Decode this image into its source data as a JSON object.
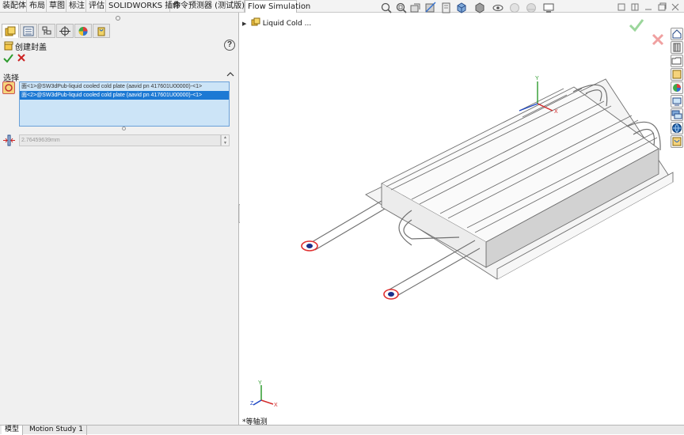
{
  "command_tabs": [
    {
      "label": "装配体",
      "active": false
    },
    {
      "label": "布局",
      "active": false
    },
    {
      "label": "草图",
      "active": false
    },
    {
      "label": "标注",
      "active": false
    },
    {
      "label": "评估",
      "active": false
    },
    {
      "label": "SOLIDWORKS 插件",
      "active": false
    },
    {
      "label": "命令预测器 (测试版)",
      "active": false
    },
    {
      "label": "Flow Simulation",
      "active": true
    }
  ],
  "manager_tabs": [
    {
      "icon": "featuremanager-icon",
      "selected": true
    },
    {
      "icon": "propertymanager-icon",
      "selected": false
    },
    {
      "icon": "configurationmanager-icon",
      "selected": false
    },
    {
      "icon": "dimxpert-icon",
      "selected": false
    },
    {
      "icon": "appearance-icon",
      "selected": false
    },
    {
      "icon": "flow-analysis-tree-icon",
      "selected": false
    }
  ],
  "property_manager": {
    "title": "创建封盖",
    "help": "?",
    "ok_icon": "checkmark-icon",
    "cancel_icon": "cross-icon",
    "selection_group": {
      "header": "选择",
      "faces": [
        "面<1>@SW3dPub-liquid cooled cold plate (aavid pn 417601U00000)-<1>",
        "面<2>@SW3dPub-liquid cooled cold plate (aavid pn 417601U00000)-<1>"
      ],
      "selected_index": 1
    },
    "thickness": {
      "value": "2.76459639mm",
      "up": "▲",
      "down": "▼"
    }
  },
  "viewport": {
    "tree_root_label": "Liquid Cold ...",
    "tree_arrow": "▶",
    "view_orientation": "*等轴测",
    "triad_labels": {
      "x": "X",
      "y": "Y",
      "z": "Z"
    }
  },
  "bottom_tabs": [
    {
      "label": "模型",
      "active": true
    },
    {
      "label": "Motion Study 1",
      "active": false
    }
  ],
  "colors": {
    "accent": "#1c79d4",
    "selection_fill": "#cce4f7",
    "ok_green": "#2e9b2e",
    "cancel_red": "#cc2222",
    "lid_highlight": "#e03030"
  }
}
